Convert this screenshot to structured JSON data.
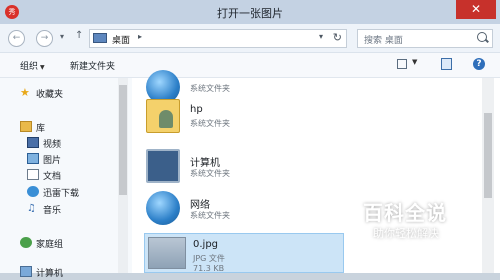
{
  "window": {
    "title": "打开一张图片",
    "close_label": "✕"
  },
  "nav": {
    "address_label": "桌面",
    "search_placeholder": "搜索 桌面"
  },
  "toolbar": {
    "organize_label": "组织",
    "new_folder_label": "新建文件夹"
  },
  "sidebar": {
    "items": [
      {
        "label": "收藏夹",
        "icon": "star-icon"
      },
      {
        "label": "库",
        "icon": "library-icon"
      },
      {
        "label": "视频",
        "icon": "video-icon"
      },
      {
        "label": "图片",
        "icon": "pictures-icon"
      },
      {
        "label": "文档",
        "icon": "documents-icon"
      },
      {
        "label": "迅雷下载",
        "icon": "download-icon"
      },
      {
        "label": "音乐",
        "icon": "music-icon"
      },
      {
        "label": "家庭组",
        "icon": "homegroup-icon"
      },
      {
        "label": "计算机",
        "icon": "computer-icon"
      }
    ]
  },
  "files": [
    {
      "name": "",
      "type": "系统文件夹",
      "icon": "network-globe-icon"
    },
    {
      "name": "hp",
      "type": "系统文件夹",
      "icon": "user-folder-icon"
    },
    {
      "name": "计算机",
      "type": "系统文件夹",
      "icon": "computer-icon"
    },
    {
      "name": "网络",
      "type": "系统文件夹",
      "icon": "network-icon"
    },
    {
      "name": "0.jpg",
      "type": "JPG 文件",
      "size": "71.3 KB",
      "icon": "image-thumbnail-icon",
      "selected": true
    }
  ],
  "watermark": {
    "title": "百科全说",
    "subtitle": "助你轻松解决"
  },
  "colors": {
    "titlebar": "#c4d2e3",
    "close": "#c7312b",
    "selection": "#cce4f7"
  }
}
